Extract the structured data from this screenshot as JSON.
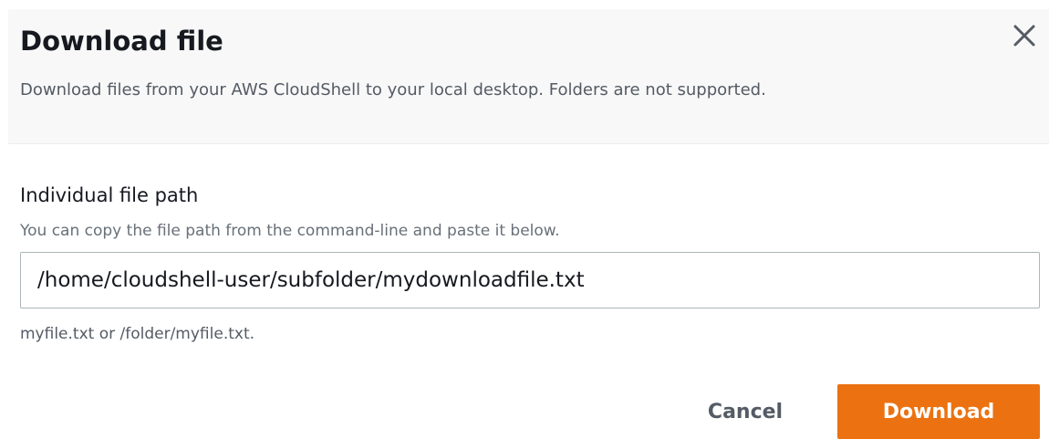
{
  "dialog": {
    "title": "Download file",
    "description": "Download files from your AWS CloudShell to your local desktop. Folders are not supported.",
    "close_icon": "close-icon"
  },
  "form": {
    "label": "Individual file path",
    "description": "You can copy the file path from the command-line and paste it below.",
    "value": "/home/cloudshell-user/subfolder/mydownloadfile.txt",
    "constraint": "myfile.txt or /folder/myfile.txt."
  },
  "footer": {
    "cancel_label": "Cancel",
    "download_label": "Download"
  },
  "colors": {
    "primary_button": "#ec7211",
    "header_background": "#f8f8f8"
  }
}
